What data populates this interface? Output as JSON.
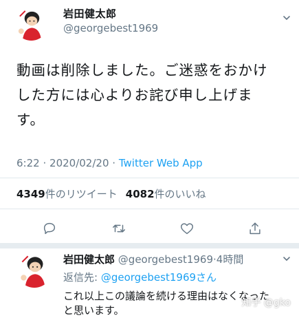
{
  "tweet": {
    "display_name": "岩田健太郎",
    "handle": "@georgebest1969",
    "text": "動画は削除しました。ご迷惑をおかけ\nした方には心よりお詫び申し上げま\nす。",
    "time": "6:22",
    "separator": "·",
    "date": "2020/02/20",
    "source": "Twitter Web App",
    "retweet_count": "4349",
    "retweet_label": "件のリツイート",
    "like_count": "4082",
    "like_label": "件のいいね"
  },
  "actions": [
    {
      "icon": "reply-icon"
    },
    {
      "icon": "retweet-icon"
    },
    {
      "icon": "like-icon"
    },
    {
      "icon": "share-icon"
    }
  ],
  "reply": {
    "display_name": "岩田健太郎",
    "handle": "@georgebest1969",
    "separator": "·",
    "time": "4時間",
    "reply_to_prefix": "返信先: ",
    "reply_to_handle": "@georgebest1969",
    "reply_to_suffix": "さん",
    "text": "これ以上この議論を続ける理由はなくなった\nと思います。"
  },
  "watermark": "知乎 @gko",
  "colors": {
    "link": "#1da1f2",
    "secondary": "#657786",
    "text": "#14171a",
    "divider": "#e1e8ed",
    "section_gap": "#e6ecf0",
    "avatar_red": "#d9232e"
  }
}
